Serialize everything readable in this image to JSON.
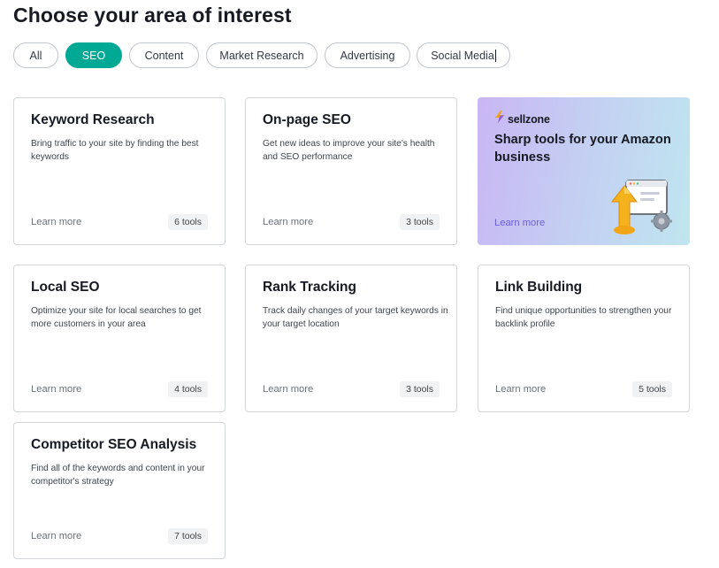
{
  "page": {
    "title": "Choose your area of interest"
  },
  "filters": [
    {
      "label": "All",
      "active": false
    },
    {
      "label": "SEO",
      "active": true
    },
    {
      "label": "Content",
      "active": false
    },
    {
      "label": "Market Research",
      "active": false
    },
    {
      "label": "Advertising",
      "active": false
    },
    {
      "label": "Social Media",
      "active": false
    }
  ],
  "cards": [
    {
      "title": "Keyword Research",
      "description": "Bring traffic to your site by finding the best keywords",
      "link": "Learn more",
      "badge": "6 tools"
    },
    {
      "title": "On-page SEO",
      "description": "Get new ideas to improve your site's health and SEO performance",
      "link": "Learn more",
      "badge": "3 tools"
    },
    {
      "title": "Local SEO",
      "description": "Optimize your site for local searches to get more customers in your area",
      "link": "Learn more",
      "badge": "4 tools"
    },
    {
      "title": "Rank Tracking",
      "description": "Track daily changes of your target keywords in your target location",
      "link": "Learn more",
      "badge": "3 tools"
    },
    {
      "title": "Link Building",
      "description": "Find unique opportunities to strengthen your backlink profile",
      "link": "Learn more",
      "badge": "5 tools"
    },
    {
      "title": "Competitor SEO Analysis",
      "description": "Find all of the keywords and content in your competitor's strategy",
      "link": "Learn more",
      "badge": "7 tools"
    }
  ],
  "promo": {
    "brand": "sellzone",
    "title": "Sharp tools for your Amazon business",
    "link": "Learn more",
    "logo_icon": "sellzone-bolt-icon",
    "art_icon": "upload-browser-gear-icon"
  },
  "colors": {
    "accent": "#00a994",
    "promo_link": "#6a5fd8",
    "text_primary": "#171a22",
    "text_muted": "#6c7279"
  }
}
